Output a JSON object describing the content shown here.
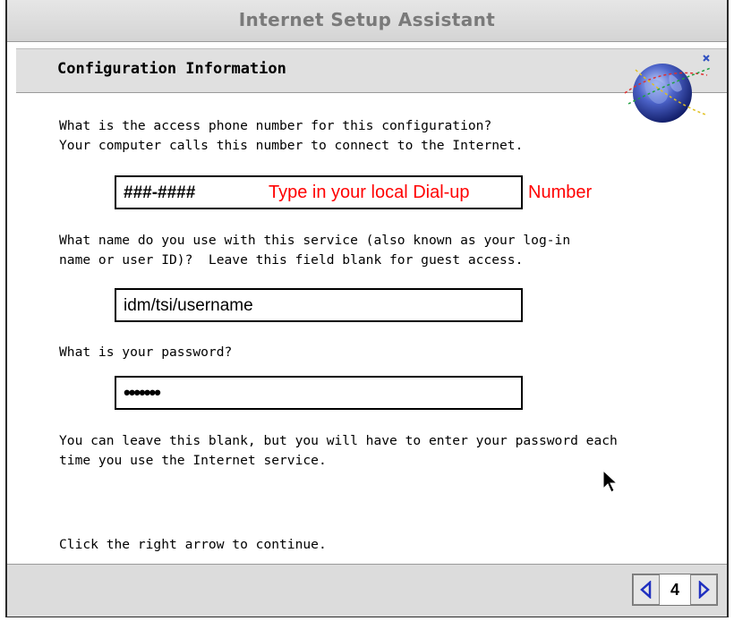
{
  "window": {
    "title": "Internet Setup Assistant"
  },
  "section": {
    "title": "Configuration Information"
  },
  "phone": {
    "question": "What is the access phone number for this configuration?\nYour computer calls this number to connect to the Internet.",
    "value": "###-####",
    "hint_in_field": "Type in your local Dial-up",
    "hint_after_field": "Number"
  },
  "username": {
    "question": "What name do you use with this service (also known as your log-in\nname or user ID)?  Leave this field blank for guest access.",
    "value": "idm/tsi/username"
  },
  "password": {
    "question": "What is your password?",
    "value": "•••••••",
    "note": "You can leave this blank, but you will have to enter your password each\ntime you use the Internet service."
  },
  "instructions": "Click the right arrow to continue.",
  "navigation": {
    "page_number": "4",
    "prev_icon": "left-arrow-icon",
    "next_icon": "right-arrow-icon"
  }
}
